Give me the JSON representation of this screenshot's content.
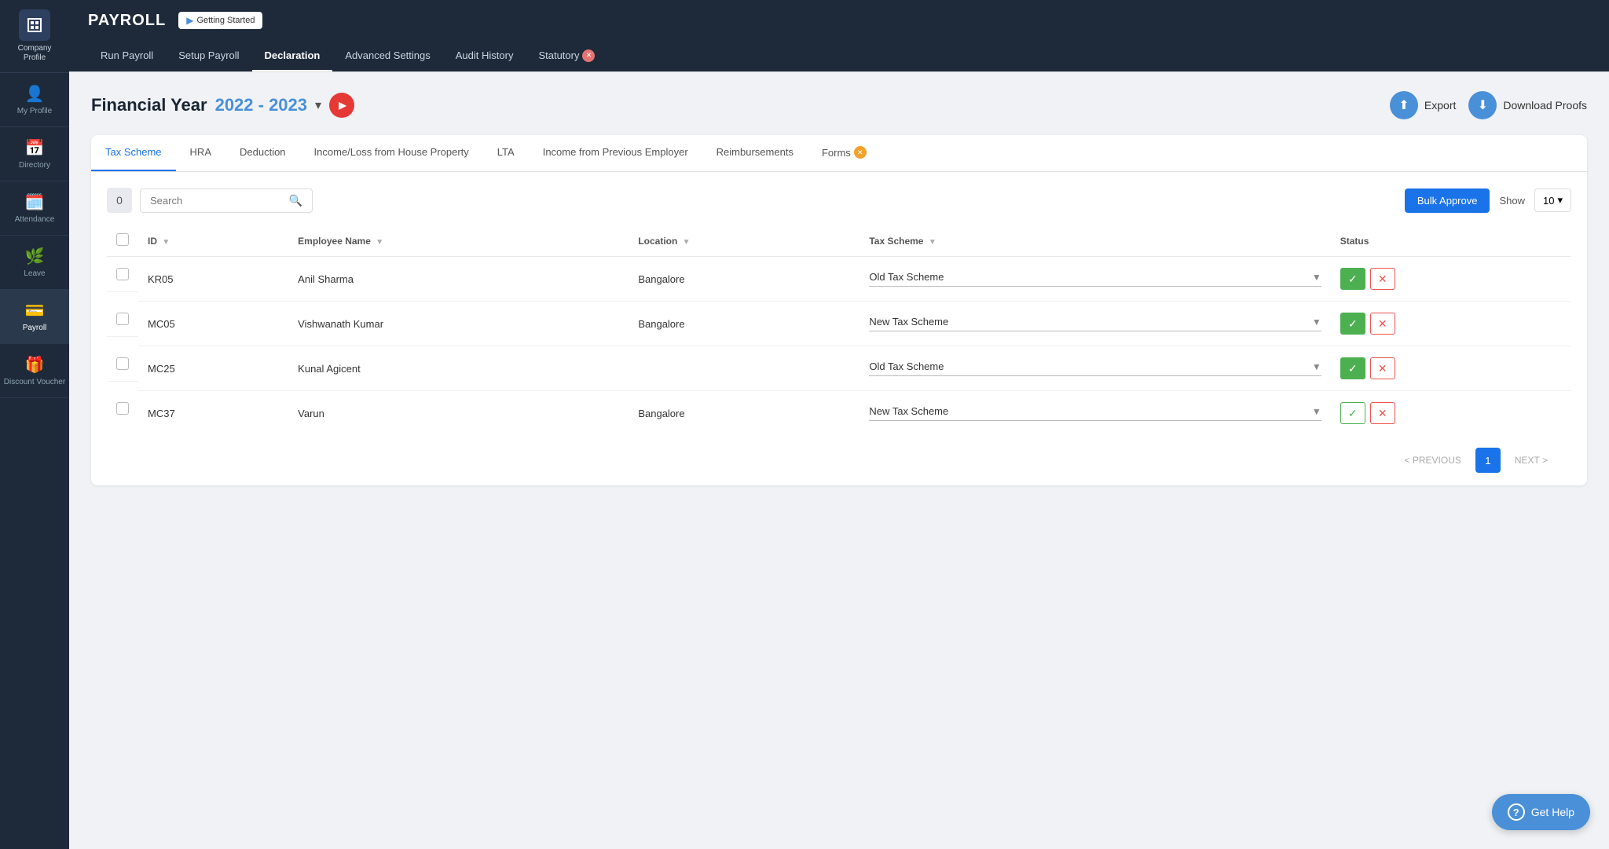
{
  "sidebar": {
    "logo_label": "Company Profile",
    "items": [
      {
        "id": "company-profile",
        "label": "Company Profile",
        "icon": "🏢"
      },
      {
        "id": "my-profile",
        "label": "My Profile",
        "icon": "👤"
      },
      {
        "id": "directory",
        "label": "Directory",
        "icon": "📅"
      },
      {
        "id": "attendance",
        "label": "Attendance",
        "icon": "🌊"
      },
      {
        "id": "leave",
        "label": "Leave",
        "icon": "🌿"
      },
      {
        "id": "payroll",
        "label": "Payroll",
        "icon": "💳",
        "active": true
      },
      {
        "id": "discount-voucher",
        "label": "Discount Voucher",
        "icon": "🎁"
      }
    ]
  },
  "topnav": {
    "brand": "PAYROLL",
    "getting_started": "Getting Started"
  },
  "navlinks": [
    {
      "label": "Run Payroll",
      "active": false
    },
    {
      "label": "Setup Payroll",
      "active": false
    },
    {
      "label": "Declaration",
      "active": true
    },
    {
      "label": "Advanced Settings",
      "active": false
    },
    {
      "label": "Audit History",
      "active": false
    },
    {
      "label": "Statutory",
      "active": false,
      "has_badge": true
    }
  ],
  "page": {
    "title": "Financial Year",
    "year": "2022 - 2023",
    "export_label": "Export",
    "download_proofs_label": "Download Proofs"
  },
  "tabs": [
    {
      "label": "Tax Scheme",
      "active": true
    },
    {
      "label": "HRA",
      "active": false
    },
    {
      "label": "Deduction",
      "active": false
    },
    {
      "label": "Income/Loss from House Property",
      "active": false
    },
    {
      "label": "LTA",
      "active": false
    },
    {
      "label": "Income from Previous Employer",
      "active": false
    },
    {
      "label": "Reimbursements",
      "active": false
    },
    {
      "label": "Forms",
      "active": false,
      "has_badge": true
    }
  ],
  "toolbar": {
    "count": "0",
    "search_placeholder": "Search",
    "bulk_approve_label": "Bulk Approve",
    "show_label": "Show",
    "show_value": "10"
  },
  "table": {
    "columns": [
      {
        "id": "checkbox",
        "label": ""
      },
      {
        "id": "id",
        "label": "ID"
      },
      {
        "id": "employee_name",
        "label": "Employee Name"
      },
      {
        "id": "location",
        "label": "Location"
      },
      {
        "id": "tax_scheme",
        "label": "Tax Scheme"
      },
      {
        "id": "status",
        "label": "Status"
      }
    ],
    "rows": [
      {
        "id": "KR05",
        "employee_name": "Anil Sharma",
        "location": "Bangalore",
        "tax_scheme": "Old Tax Scheme",
        "status": "approved"
      },
      {
        "id": "MC05",
        "employee_name": "Vishwanath Kumar",
        "location": "Bangalore",
        "tax_scheme": "New Tax Scheme",
        "status": "approved"
      },
      {
        "id": "MC25",
        "employee_name": "Kunal Agicent",
        "location": "",
        "tax_scheme": "Old Tax Scheme",
        "status": "approved"
      },
      {
        "id": "MC37",
        "employee_name": "Varun",
        "location": "Bangalore",
        "tax_scheme": "New Tax Scheme",
        "status": "outline"
      }
    ]
  },
  "pagination": {
    "previous_label": "< PREVIOUS",
    "next_label": "NEXT >",
    "current_page": "1"
  },
  "get_help": {
    "label": "Get Help"
  }
}
